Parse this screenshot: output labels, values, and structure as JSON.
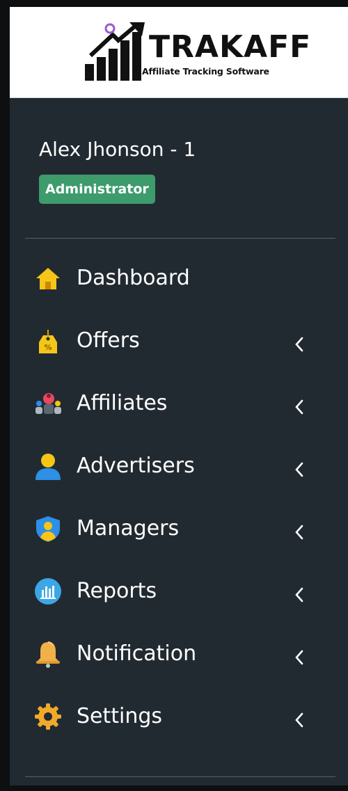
{
  "brand": {
    "name": "TRAKAFF",
    "tagline": "Affiliate Tracking Software"
  },
  "user": {
    "name": "Alex Jhonson - 1",
    "role": "Administrator"
  },
  "colors": {
    "sidebar_bg": "#222a31",
    "badge_green": "#3d9b6c",
    "icon_yellow": "#f5c518",
    "icon_blue": "#2d8fe6"
  },
  "nav": {
    "items": [
      {
        "label": "Dashboard",
        "icon": "home-icon"
      },
      {
        "label": "Offers",
        "icon": "price-tag-icon"
      },
      {
        "label": "Affiliates",
        "icon": "affiliates-group-icon"
      },
      {
        "label": "Advertisers",
        "icon": "user-icon"
      },
      {
        "label": "Managers",
        "icon": "shield-user-icon"
      },
      {
        "label": "Reports",
        "icon": "bar-chart-icon"
      },
      {
        "label": "Notification",
        "icon": "bell-icon"
      },
      {
        "label": "Settings",
        "icon": "gear-icon"
      }
    ]
  }
}
